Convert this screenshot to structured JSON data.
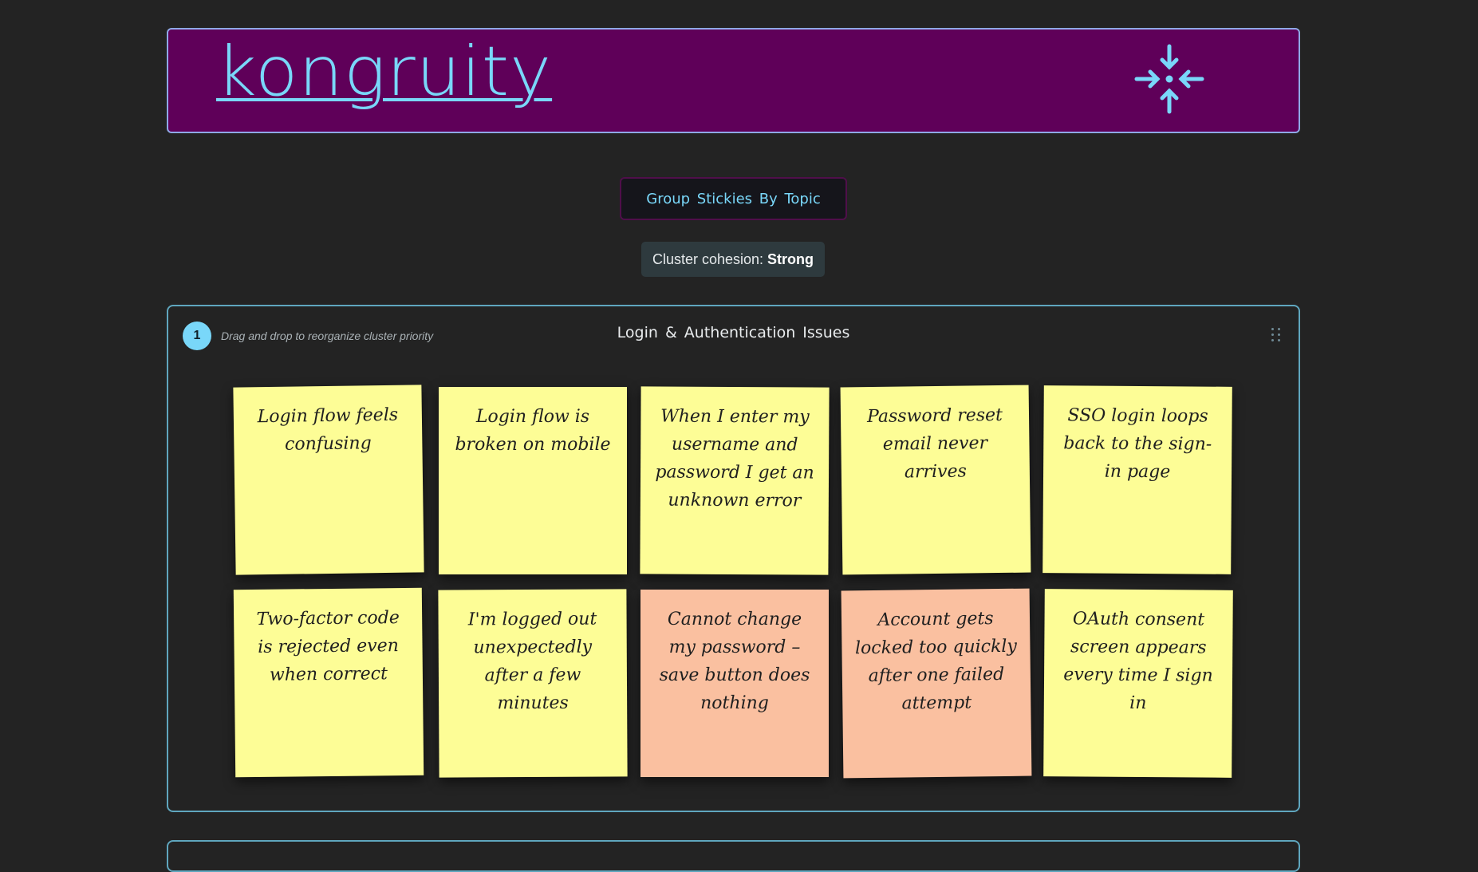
{
  "header": {
    "logo": "kongruity",
    "icon": "collapse-arrows-icon"
  },
  "toolbar": {
    "group_button_label": "Group Stickies By Topic"
  },
  "cohesion": {
    "label": "Cluster cohesion:",
    "value": "Strong"
  },
  "cluster": {
    "number": "1",
    "hint": "Drag and drop to reorganize cluster priority",
    "title": "Login & Authentication Issues",
    "stickies": [
      {
        "text": "Login flow feels confusing",
        "color": "#fdfd96"
      },
      {
        "text": "Login flow is broken on mobile",
        "color": "#fdfd96"
      },
      {
        "text": "When I enter my username and password I get an unknown error",
        "color": "#fdfd96"
      },
      {
        "text": "Password reset email never arrives",
        "color": "#fdfd96"
      },
      {
        "text": "SSO login loops back to the sign-in page",
        "color": "#fdfd96"
      },
      {
        "text": "Two-factor code is rejected even when correct",
        "color": "#fdfd96"
      },
      {
        "text": "I'm logged out unexpectedly after a few minutes",
        "color": "#fdfd96"
      },
      {
        "text": "Cannot change my password – save button does nothing",
        "color": "#fac0a0"
      },
      {
        "text": "Account gets locked too quickly after one failed attempt",
        "color": "#fac0a0"
      },
      {
        "text": "OAuth consent screen appears every time I sign in",
        "color": "#fdfd96"
      }
    ]
  },
  "colors": {
    "background": "#232323",
    "header_bg": "#5f0059",
    "accent": "#79d7f9",
    "sticky_yellow": "#fdfd96",
    "sticky_salmon": "#fac0a0"
  }
}
